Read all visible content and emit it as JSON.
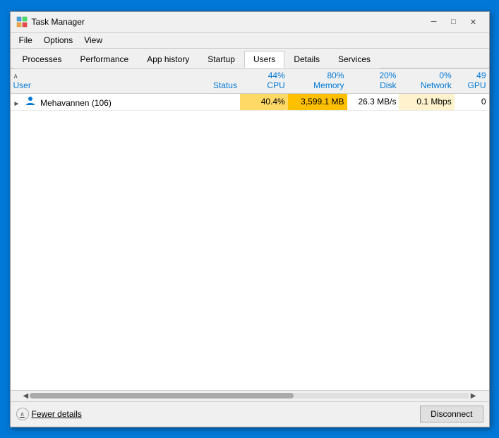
{
  "window": {
    "title": "Task Manager",
    "icon": "task-manager-icon"
  },
  "menu": {
    "items": [
      "File",
      "Options",
      "View"
    ]
  },
  "tabs": [
    {
      "label": "Processes",
      "active": false
    },
    {
      "label": "Performance",
      "active": false
    },
    {
      "label": "App history",
      "active": false
    },
    {
      "label": "Startup",
      "active": false
    },
    {
      "label": "Users",
      "active": true
    },
    {
      "label": "Details",
      "active": false
    },
    {
      "label": "Services",
      "active": false
    }
  ],
  "table": {
    "sort_arrow": "∧",
    "columns": {
      "user": "User",
      "status": "Status",
      "cpu_pct": "44%",
      "cpu_label": "CPU",
      "memory_pct": "80%",
      "memory_label": "Memory",
      "disk_pct": "20%",
      "disk_label": "Disk",
      "network_pct": "0%",
      "network_label": "Network",
      "gpu_pct": "49",
      "gpu_label": "GPU"
    },
    "rows": [
      {
        "name": "Mehavannen (106)",
        "status": "",
        "cpu": "40.4%",
        "memory": "3,599.1 MB",
        "disk": "26.3 MB/s",
        "network": "0.1 Mbps",
        "gpu": "0"
      }
    ]
  },
  "statusbar": {
    "fewer_details": "Fewer details",
    "disconnect": "Disconnect"
  },
  "titlebar": {
    "minimize": "─",
    "maximize": "□",
    "close": "✕"
  }
}
